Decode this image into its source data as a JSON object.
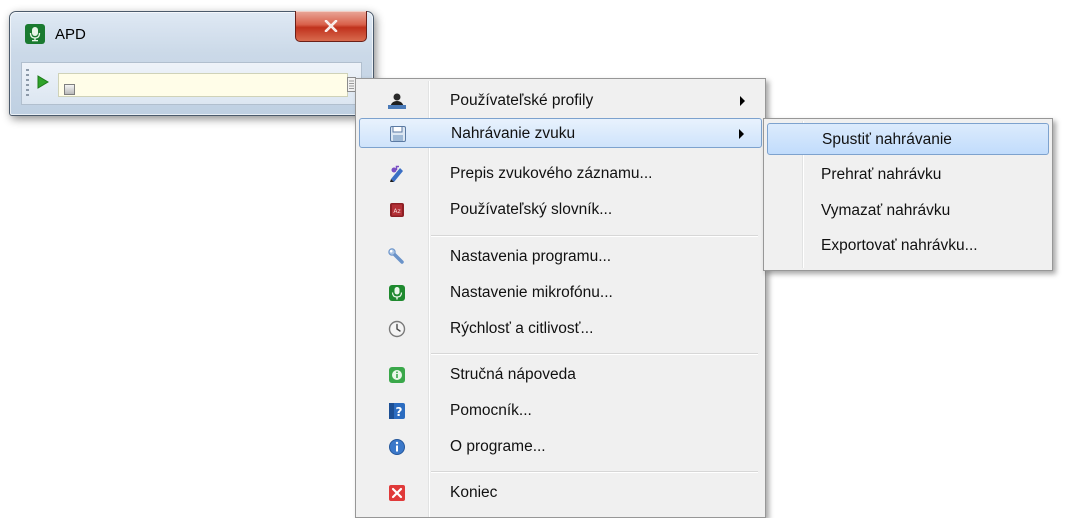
{
  "window": {
    "title": "APD",
    "icon": "microphone-icon",
    "close_icon": "close-icon"
  },
  "toolbar": {
    "play_icon": "play-icon",
    "stop_icon": "stop-icon",
    "menu_icon": "menu-dropdown-icon",
    "field_value": ""
  },
  "menu": {
    "items": [
      {
        "label": "Používateľské profily",
        "icon": "user-profile-icon",
        "submenu": true
      },
      {
        "label": "Nahrávanie zvuku",
        "icon": "save-recording-icon",
        "submenu": true,
        "highlighted": true
      },
      {
        "label": "Prepis zvukového záznamu...",
        "icon": "transcribe-icon"
      },
      {
        "label": "Používateľský slovník...",
        "icon": "dictionary-icon"
      },
      {
        "label": "Nastavenia programu...",
        "icon": "wrench-icon"
      },
      {
        "label": "Nastavenie mikrofónu...",
        "icon": "microphone-icon"
      },
      {
        "label": "Rýchlosť a citlivosť...",
        "icon": "clock-icon"
      },
      {
        "label": "Stručná nápoveda",
        "icon": "info-green-icon"
      },
      {
        "label": "Pomocník...",
        "icon": "help-icon"
      },
      {
        "label": "O programe...",
        "icon": "about-icon"
      },
      {
        "label": "Koniec",
        "icon": "exit-icon"
      }
    ]
  },
  "submenu": {
    "items": [
      {
        "label": "Spustiť nahrávanie",
        "highlighted": true
      },
      {
        "label": "Prehrať nahrávku"
      },
      {
        "label": "Vymazať nahrávku"
      },
      {
        "label": "Exportovať nahrávku..."
      }
    ]
  },
  "colors": {
    "highlight": "#cfe3fb",
    "menu_bg": "#f0f0f0",
    "field_bg": "#fffde8",
    "close_red": "#c0321d",
    "accent_green": "#1a7a30"
  }
}
